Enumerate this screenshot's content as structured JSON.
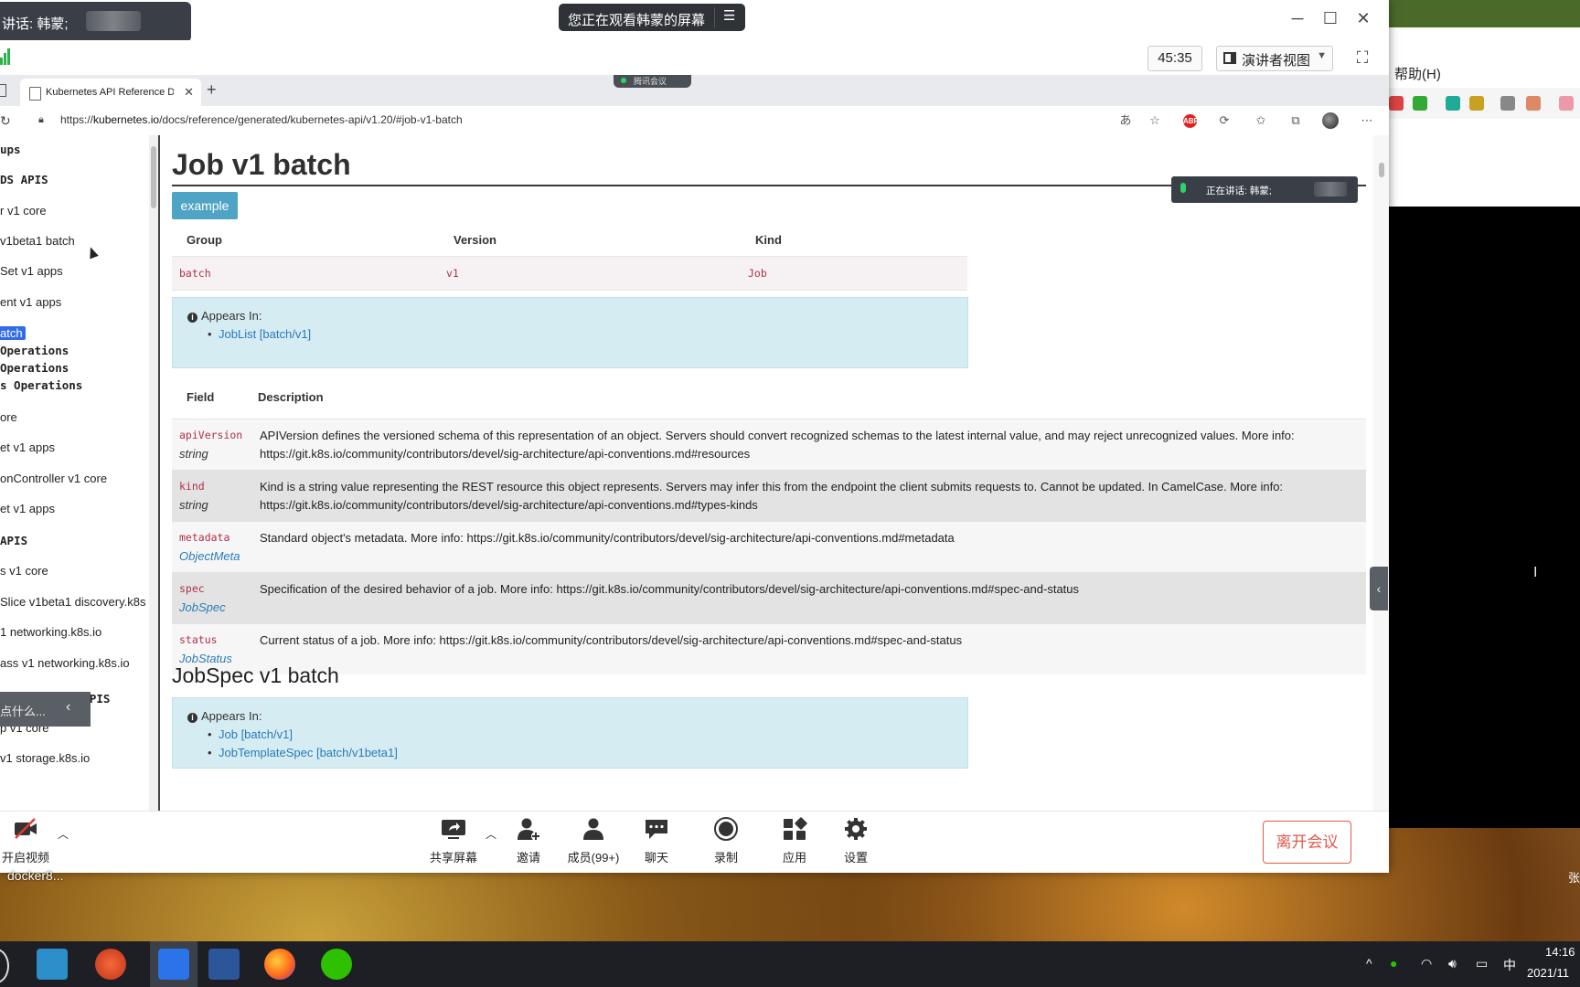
{
  "meeting": {
    "speaker_pill": "讲话: 韩蒙;",
    "watching_label": "您正在观看韩蒙的屏幕",
    "timer": "45:35",
    "view_mode": "演讲者视图",
    "tencent_tag": "腾讯会议",
    "speaking_tag": "正在讲话: 韩蒙;",
    "toolbar": [
      {
        "label": "开启视频",
        "icon": "camera-off-icon"
      },
      {
        "label": "共享屏幕",
        "icon": "share-screen-icon"
      },
      {
        "label": "邀请",
        "icon": "invite-icon"
      },
      {
        "label": "成员(99+)",
        "icon": "members-icon"
      },
      {
        "label": "聊天",
        "icon": "chat-icon"
      },
      {
        "label": "录制",
        "icon": "record-icon"
      },
      {
        "label": "应用",
        "icon": "apps-icon"
      },
      {
        "label": "设置",
        "icon": "gear-icon"
      }
    ],
    "leave_label": "离开会议",
    "participant_label": "docker8..."
  },
  "browser": {
    "tab_title": "Kubernetes API Reference Doc",
    "url_prefix": "https://",
    "url_host": "kubernetes.io",
    "url_path": "/docs/reference/generated/kubernetes-api/v1.20/#job-v1-batch"
  },
  "nav": {
    "items": [
      {
        "text": "ups",
        "head": true
      },
      {
        "text": "DS APIS",
        "head": true
      },
      {
        "text": "r v1 core"
      },
      {
        "text": "v1beta1 batch"
      },
      {
        "text": "Set v1 apps"
      },
      {
        "text": "ent v1 apps"
      },
      {
        "text": "atch",
        "selected": true
      },
      {
        "text": " Operations",
        "head": true
      },
      {
        "text": "Operations",
        "head": true
      },
      {
        "text": "s Operations",
        "head": true
      },
      {
        "text": "ore"
      },
      {
        "text": "et v1 apps"
      },
      {
        "text": "onController v1 core"
      },
      {
        "text": "et v1 apps"
      },
      {
        "text": " APIS",
        "head": true
      },
      {
        "text": "s v1 core"
      },
      {
        "text": "Slice v1beta1 discovery.k8s"
      },
      {
        "text": "1 networking.k8s.io"
      },
      {
        "text": "ass v1 networking.k8s.io"
      },
      {
        "text": "AND STORAGE APIS",
        "head": true
      },
      {
        "text": "p v1 core"
      },
      {
        "text": "v1 storage.k8s.io"
      }
    ],
    "tooltip": "点什么..."
  },
  "doc": {
    "title": "Job v1 batch",
    "example_label": "example",
    "gvk": {
      "headers": [
        "Group",
        "Version",
        "Kind"
      ],
      "values": [
        "batch",
        "v1",
        "Job"
      ]
    },
    "appears_label": "Appears In:",
    "appears_links": [
      "JobList [batch/v1]"
    ],
    "fields_headers": [
      "Field",
      "Description"
    ],
    "fields": [
      {
        "name": "apiVersion",
        "type": "string",
        "link": false,
        "desc": "APIVersion defines the versioned schema of this representation of an object. Servers should convert recognized schemas to the latest internal value, and may reject unrecognized values. More info: https://git.k8s.io/community/contributors/devel/sig-architecture/api-conventions.md#resources"
      },
      {
        "name": "kind",
        "type": "string",
        "link": false,
        "desc": "Kind is a string value representing the REST resource this object represents. Servers may infer this from the endpoint the client submits requests to. Cannot be updated. In CamelCase. More info: https://git.k8s.io/community/contributors/devel/sig-architecture/api-conventions.md#types-kinds"
      },
      {
        "name": "metadata",
        "type": "ObjectMeta",
        "link": true,
        "desc": "Standard object's metadata. More info: https://git.k8s.io/community/contributors/devel/sig-architecture/api-conventions.md#metadata"
      },
      {
        "name": "spec",
        "type": "JobSpec",
        "link": true,
        "desc": "Specification of the desired behavior of a job. More info: https://git.k8s.io/community/contributors/devel/sig-architecture/api-conventions.md#spec-and-status"
      },
      {
        "name": "status",
        "type": "JobStatus",
        "link": true,
        "desc": "Current status of a job. More info: https://git.k8s.io/community/contributors/devel/sig-architecture/api-conventions.md#spec-and-status"
      }
    ],
    "section2_title": "JobSpec v1 batch",
    "appears2_links": [
      "Job [batch/v1]",
      "JobTemplateSpec [batch/v1beta1]"
    ]
  },
  "bg_app": {
    "menu_label": "帮助(H)"
  },
  "taskbar": {
    "time": "14:16",
    "date": "2021/11",
    "ime": "中",
    "edge_char": "张"
  }
}
